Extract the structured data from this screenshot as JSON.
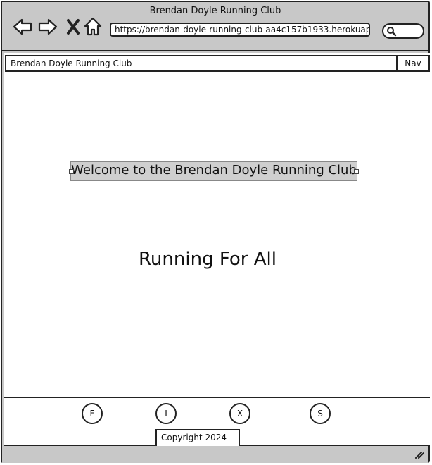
{
  "browser": {
    "window_title": "Brendan Doyle Running Club",
    "url": "https://brendan-doyle-running-club-aa4c157b1933.herokuap"
  },
  "page": {
    "brand": "Brendan Doyle Running Club",
    "nav_label": "Nav",
    "welcome": "Welcome to the Brendan Doyle Running Club",
    "tagline": "Running For All"
  },
  "footer": {
    "social": [
      {
        "label": "F"
      },
      {
        "label": "I"
      },
      {
        "label": "X"
      },
      {
        "label": "S"
      }
    ],
    "copyright": "Copyright 2024"
  }
}
